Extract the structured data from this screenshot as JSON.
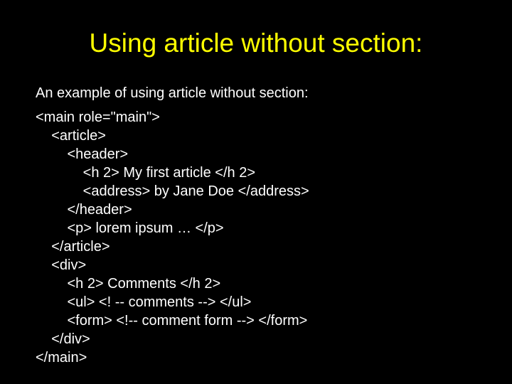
{
  "title": "Using article without section:",
  "intro": "An example of using article without section:",
  "code_lines": [
    "<main role=\"main\">",
    "    <article>",
    "        <header>",
    "            <h 2> My first article </h 2>",
    "            <address> by Jane Doe </address>",
    "        </header>",
    "        <p> lorem ipsum … </p>",
    "    </article>",
    "    <div>",
    "        <h 2> Comments </h 2>",
    "        <ul> <! -- comments --> </ul>",
    "        <form> <!-- comment form --> </form>",
    "    </div>",
    "</main>"
  ]
}
